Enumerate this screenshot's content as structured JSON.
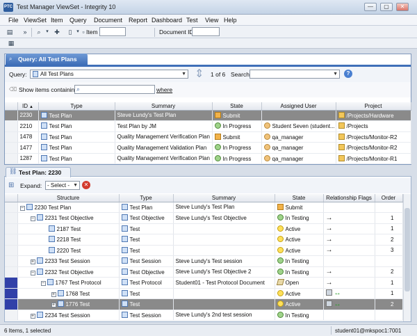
{
  "window": {
    "app_logo": "PTC",
    "title": "Test Manager ViewSet - Integrity 10",
    "controls": [
      "—",
      "▢",
      "✕"
    ]
  },
  "menubar": [
    "File",
    "ViewSet",
    "Item",
    "Query",
    "Document",
    "Report",
    "Dashboard",
    "Test",
    "View",
    "Help"
  ],
  "toolbar": {
    "more": "»",
    "item_label": "Item",
    "item_value": "",
    "docid_label": "Document ID",
    "docid_value": ""
  },
  "query_panel": {
    "tab_title": "Query: All Test Plans",
    "query_label": "Query:",
    "query_value": "All Test Plans",
    "pager": "1 of 6",
    "search_label": "Search:",
    "search_value": "",
    "filter_label": "Show items containing",
    "filter_value": "",
    "where_label": "where",
    "columns": [
      "ID",
      "Type",
      "Summary",
      "State",
      "Assigned User",
      "Project"
    ],
    "sort_indicator": "▲",
    "rows": [
      {
        "id": "2230",
        "type": "Test Plan",
        "summary": "Steve Lundy's Test Plan",
        "state": "Submit",
        "user": "",
        "project": "/Projects/Hardware",
        "selected": true
      },
      {
        "id": "2210",
        "type": "Test Plan",
        "summary": "Test Plan by JM",
        "state": "In Progress",
        "user": "Student Seven (student...",
        "project": "/Projects"
      },
      {
        "id": "1478",
        "type": "Test Plan",
        "summary": "Quality Management Verification Plan",
        "state": "Submit",
        "user": "qa_manager",
        "project": "/Projects/Monitor-R2"
      },
      {
        "id": "1477",
        "type": "Test Plan",
        "summary": "Quality Management Validation Plan",
        "state": "In Progress",
        "user": "qa_manager",
        "project": "/Projects/Monitor-R2"
      },
      {
        "id": "1287",
        "type": "Test Plan",
        "summary": "Quality Management Verification Plan",
        "state": "In Progress",
        "user": "qa_manager",
        "project": "/Projects/Monitor-R1"
      }
    ]
  },
  "plan_panel": {
    "tab_title": "Test Plan: 2230",
    "tab_close": "×",
    "expand_label": "Expand:",
    "expand_value": "- Select -",
    "columns": [
      "Structure",
      "Type",
      "Summary",
      "State",
      "Relationship Flags",
      "Order"
    ],
    "rows": [
      {
        "indent": 0,
        "toggle": "−",
        "structure": "2230 Test Plan",
        "type": "Test Plan",
        "summary": "Steve Lundy's Test Plan",
        "state": "Submit",
        "flags": "",
        "order": ""
      },
      {
        "indent": 1,
        "toggle": "−",
        "structure": "2231 Test Objective",
        "type": "Test Objective",
        "summary": "Steve Lundy's Test Objective",
        "state": "In Testing",
        "flags": "→",
        "order": "1"
      },
      {
        "indent": 2,
        "toggle": "",
        "structure": "2187 Test",
        "type": "Test",
        "summary": "",
        "state": "Active",
        "flags": "→",
        "order": "1"
      },
      {
        "indent": 2,
        "toggle": "",
        "structure": "2218 Test",
        "type": "Test",
        "summary": "",
        "state": "Active",
        "flags": "→",
        "order": "2"
      },
      {
        "indent": 2,
        "toggle": "",
        "structure": "2220 Test",
        "type": "Test",
        "summary": "",
        "state": "Active",
        "flags": "→",
        "order": "3"
      },
      {
        "indent": 1,
        "toggle": "+",
        "structure": "2233 Test Session",
        "type": "Test Session",
        "summary": "Steve Lundy's Test session",
        "state": "In Testing",
        "flags": "",
        "order": ""
      },
      {
        "indent": 1,
        "toggle": "−",
        "structure": "2232 Test Objective",
        "type": "Test Objective",
        "summary": "Steve Lundy's Test Objective 2",
        "state": "In Testing",
        "flags": "→",
        "order": "2"
      },
      {
        "indent": 2,
        "toggle": "−",
        "structure": "1767 Test Protocol",
        "type": "Test Protocol",
        "summary": "Student01 - Test Protocol Document",
        "state": "Open",
        "flags": "→",
        "order": "1"
      },
      {
        "indent": 3,
        "toggle": "+",
        "structure": "1768 Test",
        "type": "Test",
        "summary": "",
        "state": "Active",
        "flags": "↔",
        "order": "1"
      },
      {
        "indent": 3,
        "toggle": "+",
        "structure": "1776 Test",
        "type": "Test",
        "summary": "",
        "state": "Active",
        "flags": "↔",
        "order": "2",
        "selected": true
      },
      {
        "indent": 1,
        "toggle": "+",
        "structure": "2234 Test Session",
        "type": "Test Session",
        "summary": "Steve Lundy's 2nd test session",
        "state": "In Testing",
        "flags": "",
        "order": ""
      }
    ]
  },
  "statusbar": {
    "left": "6 Items, 1 selected",
    "right": "student01@mkspoc1:7001"
  }
}
